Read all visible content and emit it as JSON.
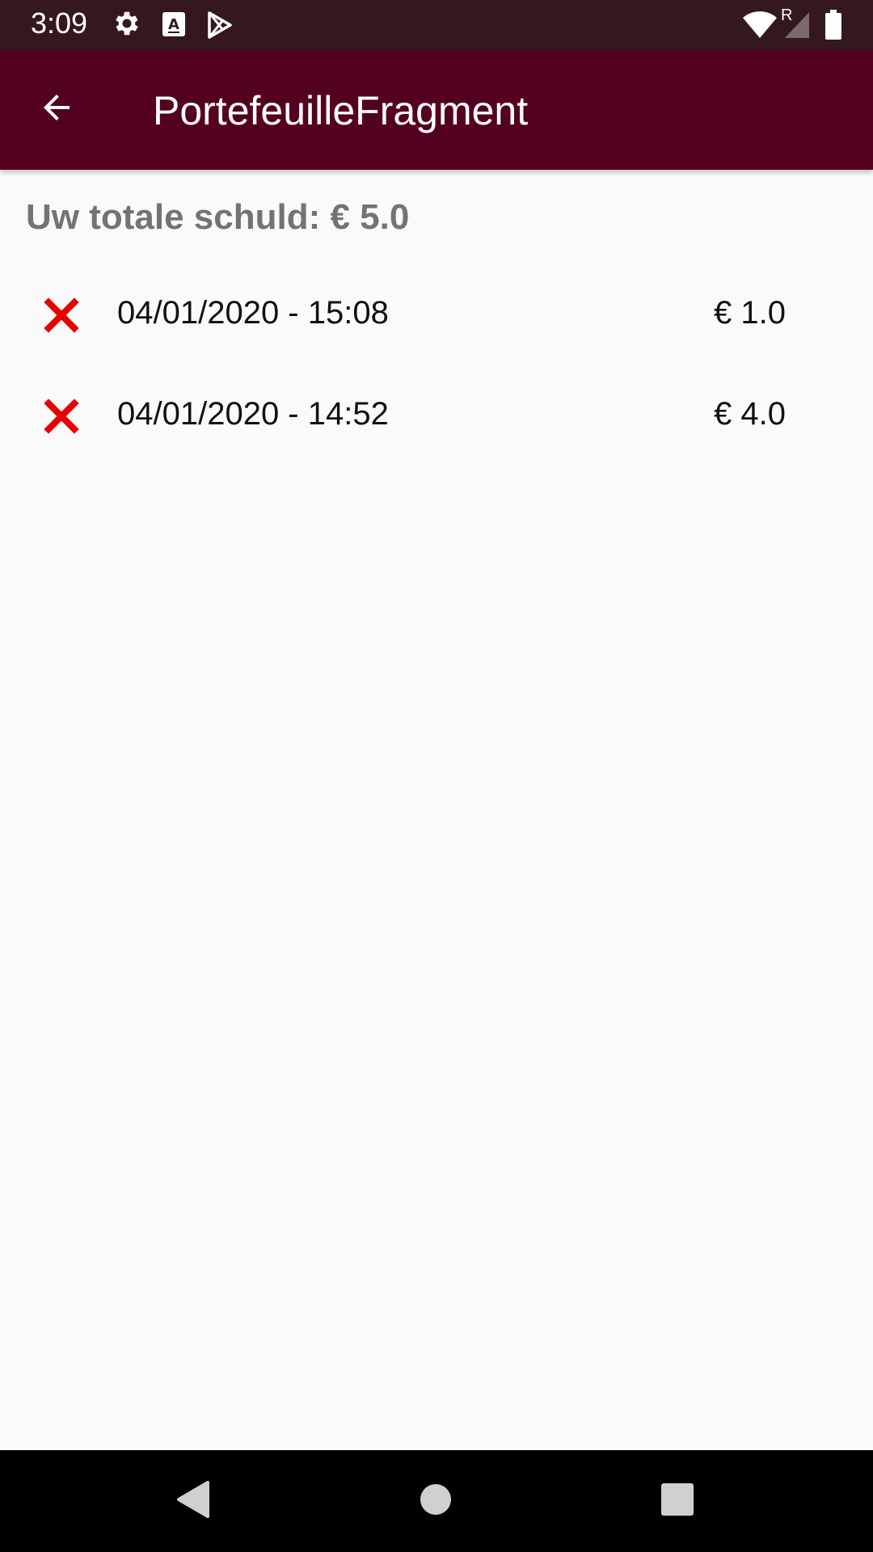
{
  "status_bar": {
    "time": "3:09",
    "icons": [
      "settings-gear-icon",
      "font-a-icon",
      "play-store-icon",
      "wifi-icon",
      "roaming-r-icon",
      "signal-icon",
      "battery-icon"
    ],
    "roaming_label": "R"
  },
  "app_bar": {
    "back_icon": "arrow-back-icon",
    "title": "PortefeuilleFragment",
    "color": "#540020"
  },
  "total": {
    "label": "Uw totale schuld: € 5.0"
  },
  "transactions": [
    {
      "icon": "delete-x-icon",
      "datetime": "04/01/2020 - 15:08",
      "amount": "€ 1.0"
    },
    {
      "icon": "delete-x-icon",
      "datetime": "04/01/2020 - 14:52",
      "amount": "€ 4.0"
    }
  ],
  "nav_bar": {
    "buttons": [
      "back-triangle-icon",
      "home-circle-icon",
      "recents-square-icon"
    ]
  },
  "colors": {
    "status_bar": "#35181e",
    "app_bar": "#540020",
    "delete_icon": "#e60000",
    "total_text": "#737373"
  }
}
